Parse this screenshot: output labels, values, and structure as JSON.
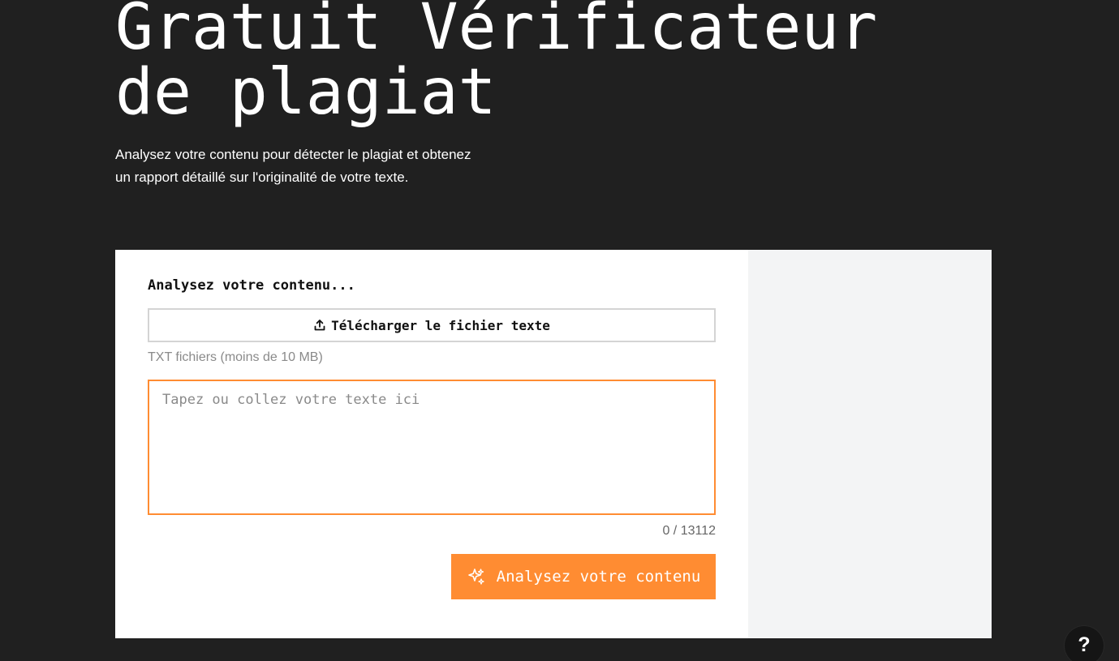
{
  "hero": {
    "title": "Gratuit Vérificateur de plagiat",
    "subtitle": "Analysez votre contenu pour détecter le plagiat et obtenez un rapport détaillé sur l'originalité de votre texte."
  },
  "card": {
    "heading": "Analysez votre contenu...",
    "upload_button": {
      "label": "Télécharger le fichier texte",
      "icon": "upload-icon"
    },
    "file_hint": "TXT fichiers (moins de 10 MB)",
    "text_input": {
      "placeholder": "Tapez ou collez votre texte ici",
      "value": ""
    },
    "character_count": "0 / 13112",
    "analyze_button": {
      "label": "Analysez votre contenu",
      "icon": "sparkle-icon"
    }
  },
  "help_button": {
    "label": "?",
    "icon": "help-icon"
  },
  "colors": {
    "page_background": "#202020",
    "card_background": "#ffffff",
    "side_panel_background": "#f3f4f5",
    "accent": "#ff8c32",
    "text_primary": "#ffffff",
    "text_dark": "#111111",
    "muted_text": "#8a8a8a"
  }
}
